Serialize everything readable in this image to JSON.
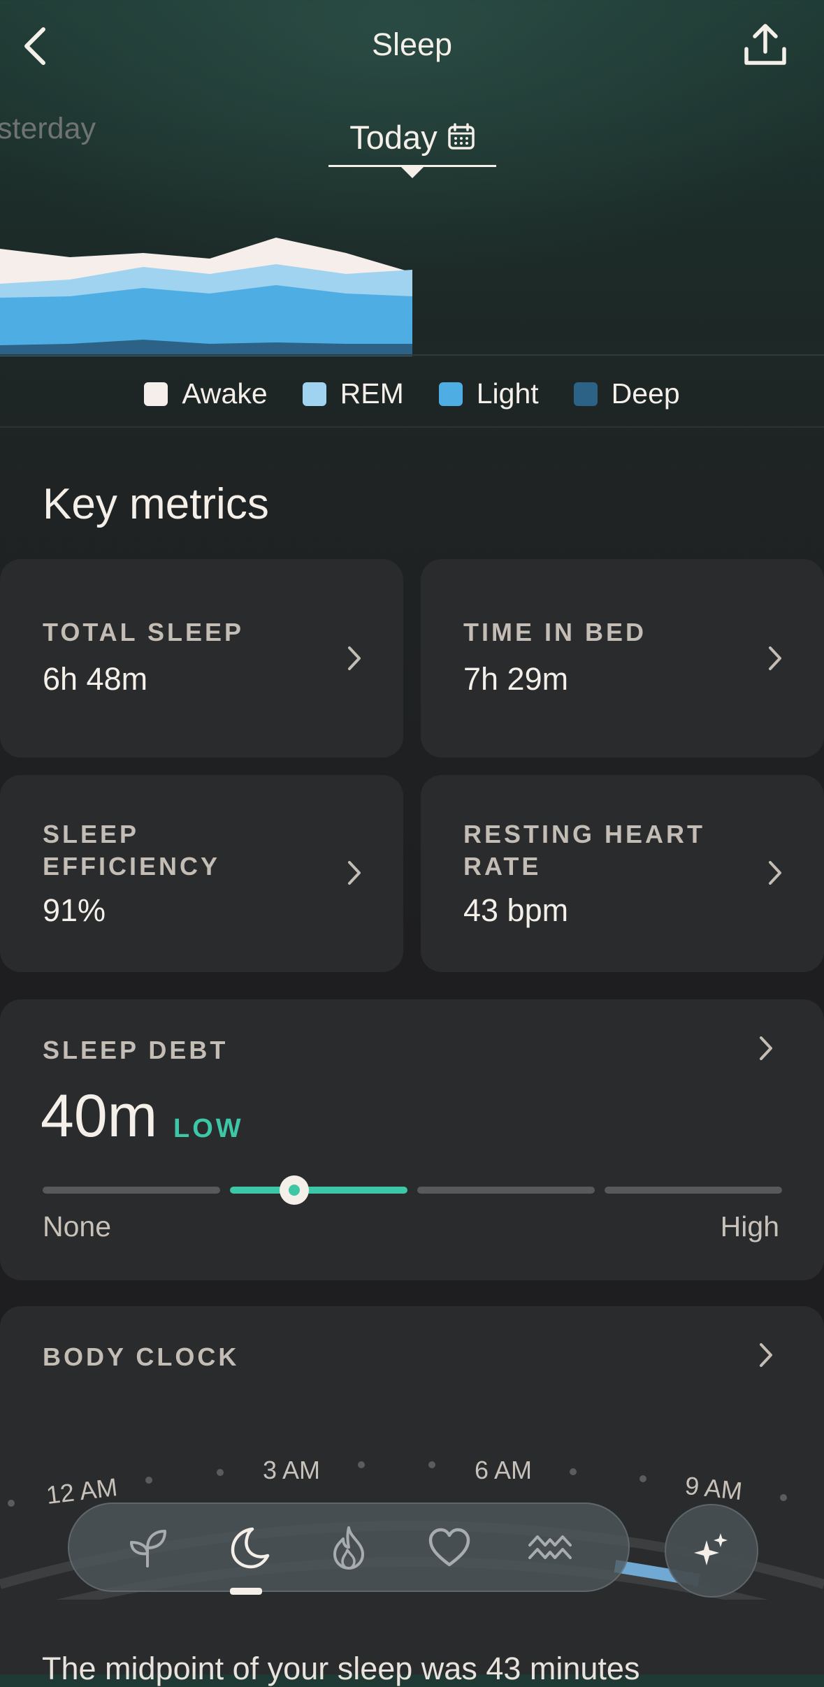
{
  "header": {
    "title": "Sleep",
    "back_icon": "chevron-left-icon",
    "share_icon": "share-icon"
  },
  "tabs": {
    "previous": "sterday",
    "current": "Today",
    "calendar_icon": "calendar-icon"
  },
  "chart_data": {
    "type": "area",
    "title": "",
    "xlabel": "",
    "ylabel": "",
    "series": [
      {
        "name": "Awake",
        "color": "#f6eeea"
      },
      {
        "name": "REM",
        "color": "#9fd3f0"
      },
      {
        "name": "Light",
        "color": "#4eaee4"
      },
      {
        "name": "Deep",
        "color": "#2c6285"
      }
    ],
    "legend_position": "bottom"
  },
  "legend": [
    {
      "label": "Awake",
      "color": "#f6eeea"
    },
    {
      "label": "REM",
      "color": "#9fd3f0"
    },
    {
      "label": "Light",
      "color": "#4eaee4"
    },
    {
      "label": "Deep",
      "color": "#2c6285"
    }
  ],
  "key_metrics": {
    "title": "Key metrics",
    "cards": [
      {
        "label": "TOTAL SLEEP",
        "value": "6h 48m"
      },
      {
        "label": "TIME IN BED",
        "value": "7h 29m"
      },
      {
        "label": "SLEEP EFFICIENCY",
        "value": "91%"
      },
      {
        "label": "RESTING HEART RATE",
        "value": "43 bpm"
      }
    ]
  },
  "sleep_debt": {
    "label": "SLEEP DEBT",
    "value": "40m",
    "level": "LOW",
    "min_label": "None",
    "max_label": "High",
    "level_fraction": 0.34
  },
  "body_clock": {
    "label": "BODY CLOCK",
    "times": [
      "12 AM",
      "3 AM",
      "6 AM",
      "9 AM"
    ]
  },
  "summary_text": "The midpoint of your sleep was 43 minutes",
  "nav": {
    "items": [
      "sprout-icon",
      "moon-icon",
      "flame-icon",
      "heart-icon",
      "waves-icon"
    ],
    "active": "moon-icon",
    "assistant_icon": "sparkle-icon"
  },
  "colors": {
    "accent": "#3dc7a6",
    "card": "#292b2d"
  }
}
